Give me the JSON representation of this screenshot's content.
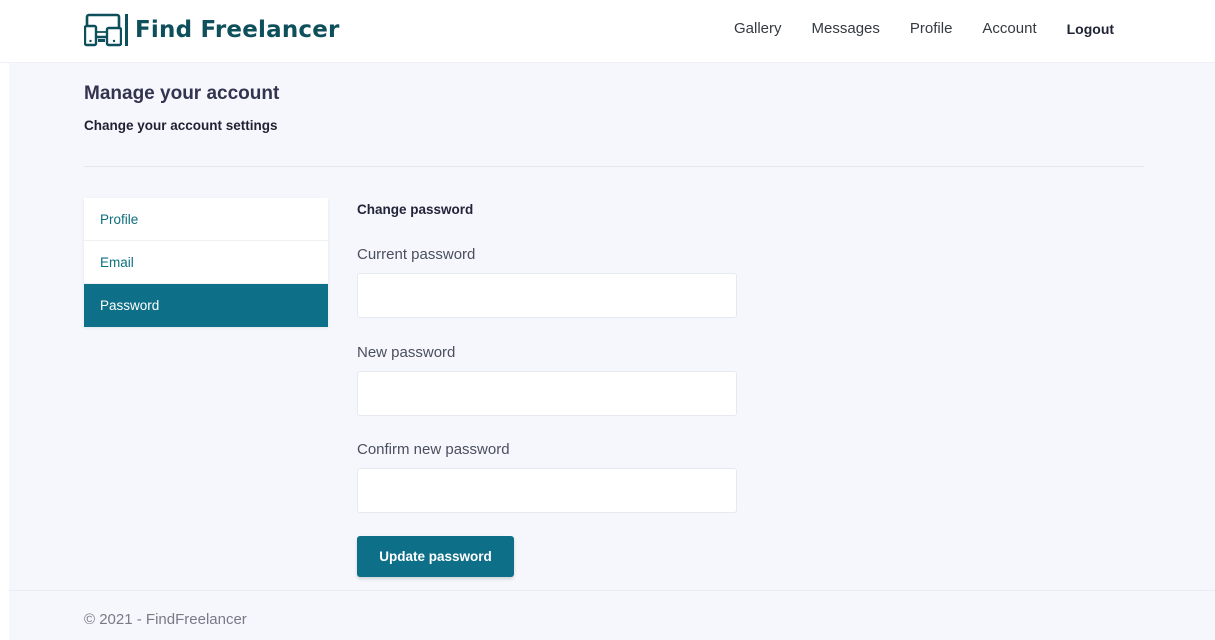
{
  "brand": {
    "name": "Find Freelancer",
    "icon": "devices-icon",
    "color": "#0d4f5b"
  },
  "nav": {
    "gallery": "Gallery",
    "messages": "Messages",
    "profile": "Profile",
    "account": "Account",
    "logout": "Logout"
  },
  "page": {
    "title": "Manage your account",
    "subtitle": "Change your account settings"
  },
  "sidebar": {
    "items": [
      {
        "label": "Profile",
        "active": false
      },
      {
        "label": "Email",
        "active": false
      },
      {
        "label": "Password",
        "active": true
      }
    ]
  },
  "form": {
    "heading": "Change password",
    "current_label": "Current password",
    "current_value": "",
    "new_label": "New password",
    "new_value": "",
    "confirm_label": "Confirm new password",
    "confirm_value": "",
    "submit_label": "Update password"
  },
  "footer": {
    "text": "© 2021 - FindFreelancer"
  },
  "colors": {
    "accent": "#0e6f88",
    "background": "#f5f7fc"
  }
}
